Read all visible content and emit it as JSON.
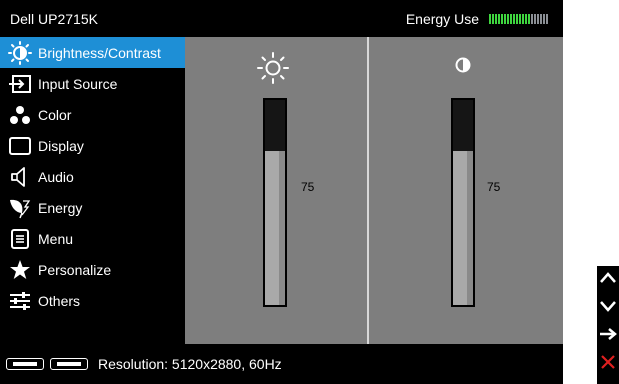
{
  "header": {
    "model": "Dell UP2715K",
    "energy_label": "Energy Use",
    "energy_level": 0.7
  },
  "sidebar": {
    "items": [
      {
        "label": "Brightness/Contrast",
        "icon": "brightness-contrast-icon",
        "active": true
      },
      {
        "label": "Input Source",
        "icon": "input-source-icon"
      },
      {
        "label": "Color",
        "icon": "color-icon"
      },
      {
        "label": "Display",
        "icon": "display-icon"
      },
      {
        "label": "Audio",
        "icon": "audio-icon"
      },
      {
        "label": "Energy",
        "icon": "energy-leaf-icon"
      },
      {
        "label": "Menu",
        "icon": "menu-icon"
      },
      {
        "label": "Personalize",
        "icon": "star-icon"
      },
      {
        "label": "Others",
        "icon": "others-sliders-icon"
      }
    ]
  },
  "controls": {
    "brightness": {
      "icon": "sun-icon",
      "value": "75",
      "level": 0.75
    },
    "contrast": {
      "icon": "contrast-icon",
      "value": "75",
      "level": 0.75
    }
  },
  "status": {
    "resolution": "Resolution: 5120x2880, 60Hz",
    "ports": [
      "displayport-connector-icon",
      "displayport-connector-icon"
    ]
  },
  "buttons": [
    {
      "icon": "up-arrow-icon"
    },
    {
      "icon": "down-arrow-icon"
    },
    {
      "icon": "enter-arrow-icon"
    },
    {
      "icon": "exit-x-icon",
      "color": "#e02020"
    }
  ],
  "colors": {
    "accent": "#1e8fd6",
    "panel": "#7e7e7e",
    "energy_on": "#3fd63f",
    "energy_off": "#8b8f95"
  }
}
